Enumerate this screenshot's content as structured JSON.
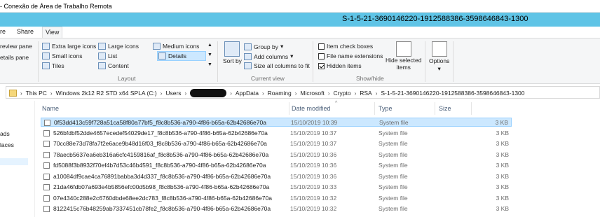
{
  "window_title": "- Conexão de Área de Trabalho Remota",
  "explorer_title": "S-1-5-21-3690146220-1912588386-3598646843-1300",
  "ribbon_tabs": [
    "re",
    "Share",
    "View"
  ],
  "panes": {
    "preview": "review pane",
    "details": "etails pane"
  },
  "layout": {
    "items": [
      "Extra large icons",
      "Large icons",
      "Medium icons",
      "Small icons",
      "List",
      "Details",
      "Tiles",
      "Content"
    ],
    "selected": "Details",
    "label": "Layout"
  },
  "current_view": {
    "sort_by": "Sort by",
    "group_by": "Group by",
    "add_columns": "Add columns",
    "size_all": "Size all columns to fit",
    "label": "Current view"
  },
  "show_hide": {
    "item_checkboxes": "Item check boxes",
    "file_extensions": "File name extensions",
    "hidden_items": "Hidden items",
    "hide_selected_1": "Hide selected",
    "hide_selected_2": "items",
    "options": "Options",
    "label": "Show/hide"
  },
  "address": [
    "This PC",
    "Windows 2k12 R2 STD x64 SPLA (C:)",
    "Users",
    "AppData",
    "Roaming",
    "Microsoft",
    "Crypto",
    "RSA",
    "S-1-5-21-3690146220-1912588386-3598646843-1300"
  ],
  "nav": [
    "ads",
    "laces"
  ],
  "columns": {
    "name": "Name",
    "date": "Date modified",
    "type": "Type",
    "size": "Size"
  },
  "files": [
    {
      "name": "0f53dd413c59f728a51ca58f80a77bf5_f8c8b536-a790-4f86-b65a-62b42686e70a",
      "date": "15/10/2019 10:39",
      "type": "System file",
      "size": "3 KB"
    },
    {
      "name": "526bfdbf52dde4657ecedef54029de17_f8c8b536-a790-4f86-b65a-62b42686e70a",
      "date": "15/10/2019 10:37",
      "type": "System file",
      "size": "3 KB"
    },
    {
      "name": "70cc88e73d78fa7f2e6ace9b48d16f03_f8c8b536-a790-4f86-b65a-62b42686e70a",
      "date": "15/10/2019 10:37",
      "type": "System file",
      "size": "3 KB"
    },
    {
      "name": "78aecb5637ea6eb316a6cfc4159816af_f8c8b536-a790-4f86-b65a-62b42686e70a",
      "date": "15/10/2019 10:36",
      "type": "System file",
      "size": "3 KB"
    },
    {
      "name": "fd5088f3b8932f70ef4b7d53c46b4591_f8c8b536-a790-4f86-b65a-62b42686e70a",
      "date": "15/10/2019 10:36",
      "type": "System file",
      "size": "3 KB"
    },
    {
      "name": "a10084df9cae4ca76891babba3d4d337_f8c8b536-a790-4f86-b65a-62b42686e70a",
      "date": "15/10/2019 10:36",
      "type": "System file",
      "size": "3 KB"
    },
    {
      "name": "21da46fdb07a693e4b5856efc00d5b98_f8c8b536-a790-4f86-b65a-62b42686e70a",
      "date": "15/10/2019 10:33",
      "type": "System file",
      "size": "3 KB"
    },
    {
      "name": "07e4340c288e2c6760dbde68ee2dc783_f8c8b536-a790-4f86-b65a-62b42686e70a",
      "date": "15/10/2019 10:32",
      "type": "System file",
      "size": "3 KB"
    },
    {
      "name": "8122415c76b48259ab7337451cb78fe2_f8c8b536-a790-4f86-b65a-62b42686e70a",
      "date": "15/10/2019 10:32",
      "type": "System file",
      "size": "3 KB"
    }
  ]
}
